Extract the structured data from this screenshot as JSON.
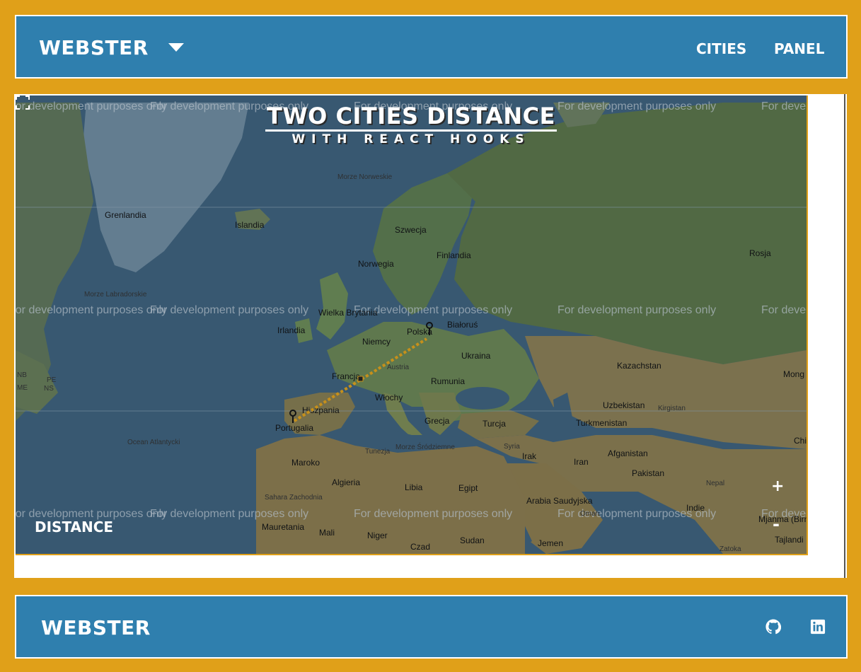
{
  "header": {
    "brand": "WEBSTER",
    "nav": [
      {
        "label": "CITIES"
      },
      {
        "label": "PANEL"
      }
    ]
  },
  "map": {
    "title": "TWO CITIES DISTANCE",
    "subtitle": "WITH REACT HOOKS",
    "watermark": "For development purposes only",
    "distance_label": "DISTANCE",
    "zoom_in": "+",
    "zoom_out": "-",
    "route_color": "#e0a019",
    "place_labels": {
      "grenlandia": "Grenlandia",
      "islandia": "Islandia",
      "morze_norweskie": "Morze Norweskie",
      "szwecja": "Szwecja",
      "finlandia": "Finlandia",
      "rosja": "Rosja",
      "norwegia": "Norwegia",
      "morze_labradorskie": "Morze Labradorskie",
      "wielka_brytania": "Wielka Brytania",
      "irlandia": "Irlandia",
      "polska": "Polska",
      "bialorus": "Białoruś",
      "niemcy": "Niemcy",
      "ukraina": "Ukraina",
      "kazachstan": "Kazachstan",
      "mong": "Mong",
      "francja": "Francja",
      "austria": "Austria",
      "rumunia": "Rumunia",
      "hiszpania": "Hiszpania",
      "wlochy": "Włochy",
      "uzbekistan": "Uzbekistan",
      "kirgistan": "Kirgistan",
      "portugalia": "Portugalia",
      "grecja": "Grecja",
      "turcja": "Turcja",
      "turkmenistan": "Turkmenistan",
      "ocean_atlantycki": "Ocean Atlantycki",
      "tunezja": "Tunezja",
      "morze_srodziemne": "Morze Śródziemne",
      "syria": "Syria",
      "irak": "Irak",
      "iran": "Iran",
      "afganistan": "Afganistan",
      "chi": "Chi",
      "maroko": "Maroko",
      "algieria": "Algieria",
      "libia": "Libia",
      "egipt": "Egipt",
      "pakistan": "Pakistan",
      "nepal": "Nepal",
      "sahara_zachodnia": "Sahara Zachodnia",
      "arabia_saudyjska": "Arabia Saudyjska",
      "indie": "Indie",
      "mjanma": "Mjanma (Birma)",
      "oman": "Oman",
      "mauretania": "Mauretania",
      "mali": "Mali",
      "niger": "Niger",
      "sudan": "Sudan",
      "jemen": "Jemen",
      "czad": "Czad",
      "zatoka": "Zatoka",
      "tajlandia": "Tajlandi",
      "nb": "NB",
      "pe": "PE",
      "ns": "NS",
      "me": "ME"
    }
  },
  "footer": {
    "brand": "WEBSTER",
    "icons": [
      "github-icon",
      "linkedin-icon"
    ]
  }
}
